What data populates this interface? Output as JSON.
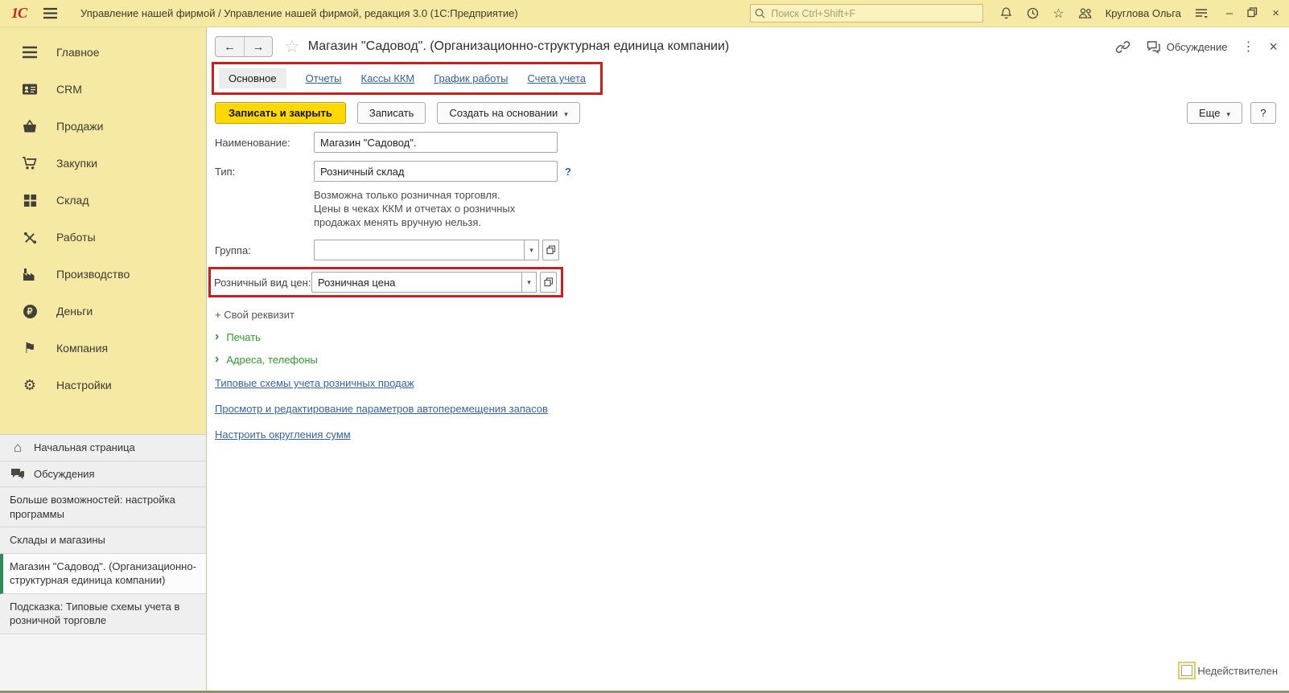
{
  "topbar": {
    "logo": "1С",
    "title": "Управление нашей фирмой / Управление нашей фирмой, редакция 3.0 (1С:Предприятие)",
    "search_placeholder": "Поиск Ctrl+Shift+F",
    "user_name": "Круглова Ольга"
  },
  "icons": {
    "back": "←",
    "forward": "→",
    "favorite_star": "☆",
    "topbar_star": "☆",
    "more_dots": "⋮",
    "close": "×",
    "minimize": "–",
    "dropdown": "▾",
    "chevron": "›",
    "home": "⌂",
    "gear": "⚙",
    "flag": "⚑",
    "ruble": "₽"
  },
  "sidebar": {
    "items": [
      {
        "label": "Главное"
      },
      {
        "label": "CRM"
      },
      {
        "label": "Продажи"
      },
      {
        "label": "Закупки"
      },
      {
        "label": "Склад"
      },
      {
        "label": "Работы"
      },
      {
        "label": "Производство"
      },
      {
        "label": "Деньги"
      },
      {
        "label": "Компания"
      },
      {
        "label": "Настройки"
      }
    ]
  },
  "leftpanel": {
    "items": [
      {
        "label": "Начальная страница"
      },
      {
        "label": "Обсуждения"
      },
      {
        "label": "Больше возможностей: настройка программы"
      },
      {
        "label": "Склады и магазины"
      },
      {
        "label": "Магазин \"Садовод\". (Организационно-структурная единица компании)"
      },
      {
        "label": "Подсказка: Типовые схемы учета в розничной торговле"
      }
    ]
  },
  "content": {
    "title": "Магазин \"Садовод\". (Организационно-структурная единица компании)",
    "discussion_label": "Обсуждение",
    "tabs": [
      {
        "label": "Основное"
      },
      {
        "label": "Отчеты"
      },
      {
        "label": "Кассы ККМ"
      },
      {
        "label": "График работы"
      },
      {
        "label": "Счета учета"
      }
    ],
    "toolbar": {
      "save_close": "Записать и закрыть",
      "save": "Записать",
      "create_based": "Создать на основании",
      "more": "Еще",
      "help": "?"
    },
    "form": {
      "name_label": "Наименование:",
      "name_value": "Магазин \"Садовод\".",
      "type_label": "Тип:",
      "type_value": "Розничный склад",
      "type_help": "?",
      "type_hint_line1": "Возможна только розничная торговля.",
      "type_hint_line2": "Цены в чеках ККМ и отчетах о розничных",
      "type_hint_line3": "продажах менять вручную нельзя.",
      "group_label": "Группа:",
      "group_value": "",
      "retail_price_label": "Розничный вид цен:",
      "retail_price_value": "Розничная цена",
      "add_attribute": "+ Свой реквизит",
      "collapse_print": "Печать",
      "collapse_addresses": "Адреса, телефоны",
      "link_schemes": "Типовые схемы учета розничных продаж",
      "link_autotransfer": "Просмотр и редактирование параметров автоперемещения запасов",
      "link_rounding": "Настроить округления сумм",
      "invalid_checkbox": "Недействителен"
    }
  },
  "colors": {
    "brand_yellow": "#f6e9a4",
    "highlight_red": "#cf1d1d",
    "link_blue": "#3464a8",
    "green_link": "#2b9e2b",
    "primary_button_yellow": "#ffd800",
    "active_item_green": "#2e8b57"
  }
}
